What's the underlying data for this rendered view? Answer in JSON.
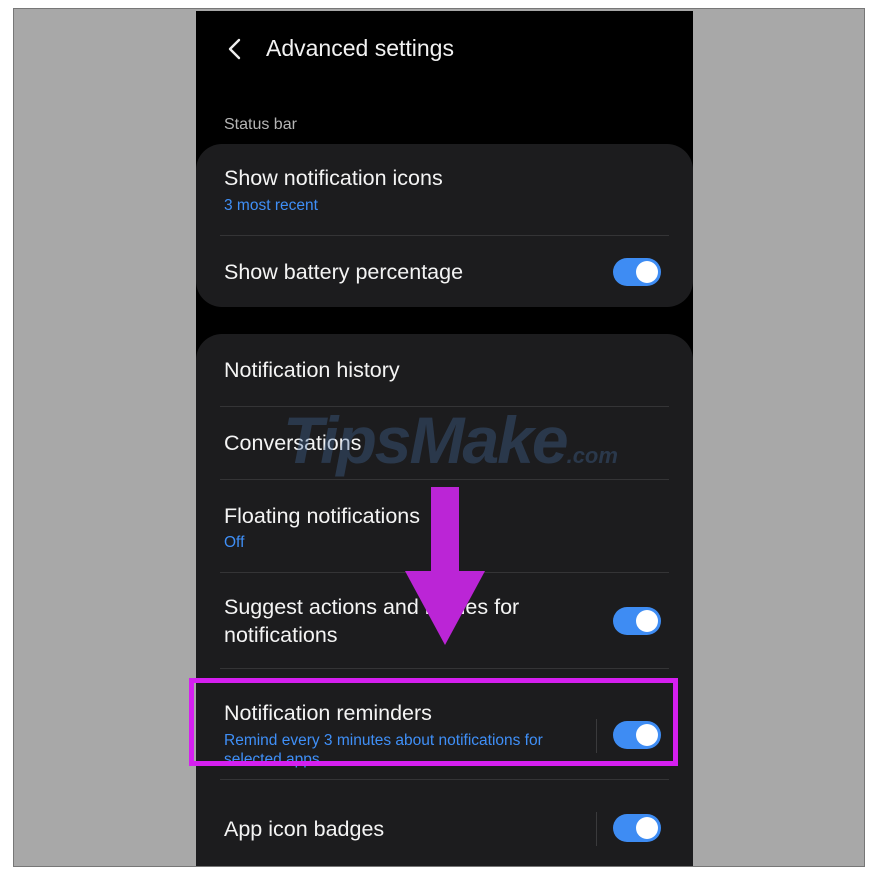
{
  "header": {
    "title": "Advanced settings"
  },
  "status_bar_section": {
    "label": "Status bar",
    "show_notification_icons": {
      "label": "Show notification icons",
      "value": "3 most recent"
    },
    "show_battery_percentage": {
      "label": "Show battery percentage",
      "toggle": "on"
    }
  },
  "notifications_section": {
    "notification_history": {
      "label": "Notification history"
    },
    "conversations": {
      "label": "Conversations"
    },
    "floating_notifications": {
      "label": "Floating notifications",
      "value": "Off"
    },
    "suggest_actions": {
      "label_line1": "Suggest actions and replies for",
      "label_line2": "notifications",
      "toggle": "on"
    },
    "notification_reminders": {
      "label": "Notification reminders",
      "sub_line1": "Remind every 3 minutes about notifications for",
      "sub_line2": "selected apps",
      "toggle": "on"
    },
    "app_icon_badges": {
      "label": "App icon badges",
      "toggle": "on"
    }
  },
  "watermark": {
    "main": "TipsMake",
    "suffix": ".com"
  },
  "colors": {
    "accent": "#3e8cf3",
    "highlight": "#d51ff0",
    "card": "#1c1c1e",
    "background": "#000000"
  },
  "icons": {
    "back": "chevron-left-icon",
    "arrow": "down-arrow-icon"
  }
}
